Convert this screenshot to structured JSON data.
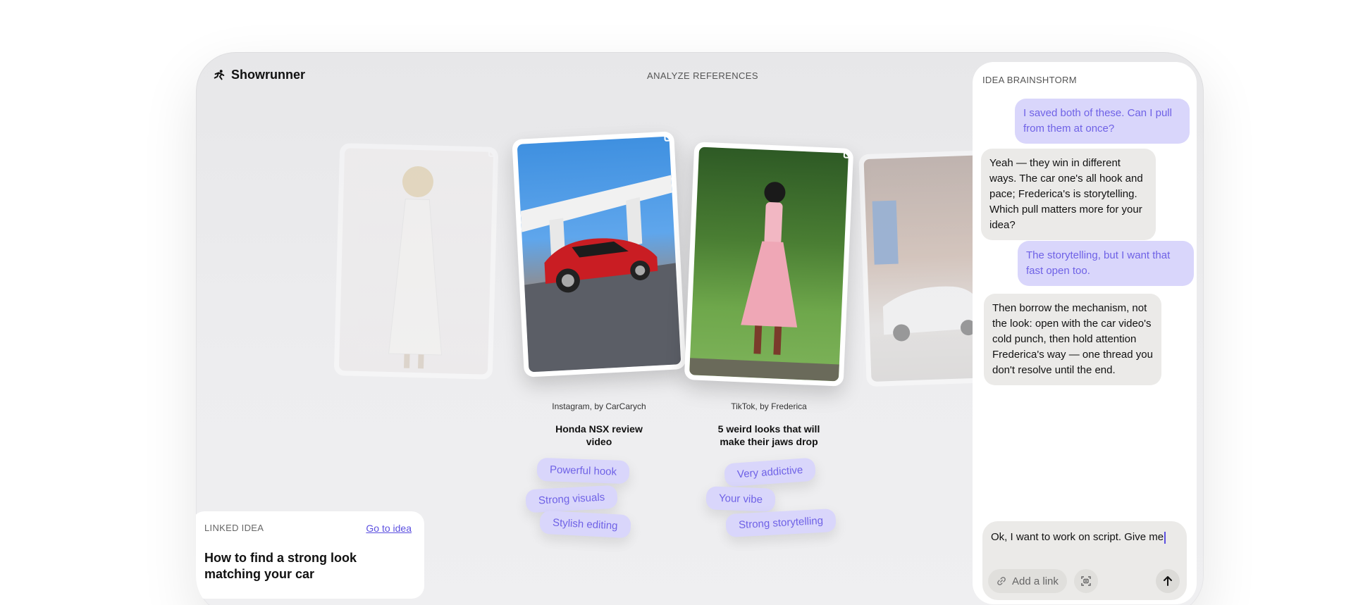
{
  "app": {
    "brand": "Showrunner",
    "screen_title": "ANALYZE REFERENCES"
  },
  "references": [
    {
      "source": "Instagram, by CarCarych",
      "title": "Honda NSX review video",
      "tags": [
        "Powerful hook",
        "Strong visuals",
        "Stylish editing"
      ]
    },
    {
      "source": "TikTok, by Frederica",
      "title": "5 weird looks that will make their jaws drop",
      "tags": [
        "Very addictive",
        "Your vibe",
        "Strong storytelling"
      ]
    }
  ],
  "linked_idea": {
    "label": "LINKED IDEA",
    "go_label": "Go to idea",
    "idea": "How to find a strong look matching your car"
  },
  "brainstorm": {
    "title": "IDEA BRAINSHTORM",
    "messages": [
      {
        "role": "user",
        "text": "I saved both of these. Can I pull from them at once?"
      },
      {
        "role": "assistant",
        "text": "Yeah — they win in different ways. The car one's all hook and pace; Frederica's is storytelling. Which pull matters more for your idea?"
      },
      {
        "role": "user",
        "text": "The storytelling, but I want that fast open too."
      },
      {
        "role": "assistant",
        "text": "Then borrow the mechanism, not the look: open with the car video's cold punch, then hold attention Frederica's way — one thread you don't resolve until the end."
      }
    ],
    "composer": {
      "value": "Ok, I want to work on script. Give me",
      "add_link_label": "Add a link"
    }
  },
  "colors": {
    "accent": "#6f62e6",
    "chip_bg": "#d9d6fb",
    "bot_bubble": "#ebeae8"
  }
}
